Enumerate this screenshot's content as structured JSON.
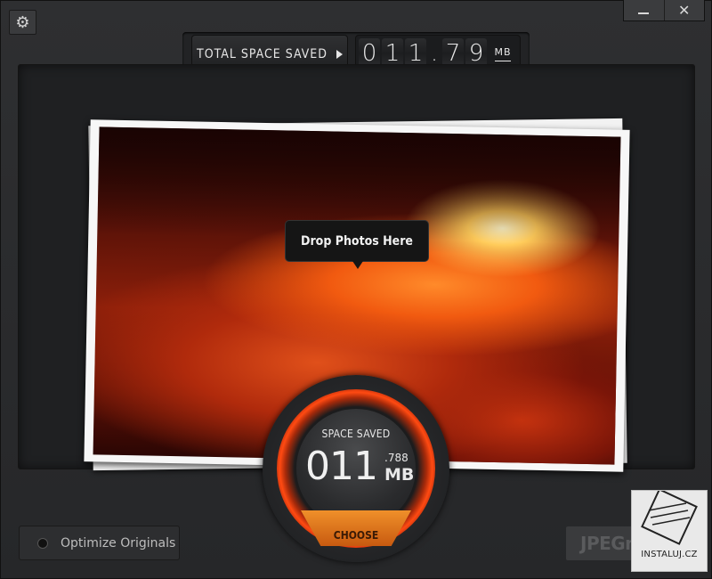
{
  "window": {
    "settings_icon": "gear-icon",
    "minimize_icon": "minimize-icon",
    "close_symbol": "✕",
    "close_icon": "close-icon"
  },
  "counter_header": {
    "label": "TOTAL SPACE SAVED",
    "label_icon": "play-arrow-icon",
    "digits": [
      "0",
      "1",
      "1",
      ".",
      "7",
      "9"
    ],
    "unit": "MB"
  },
  "drop_zone": {
    "tooltip": "Drop Photos Here"
  },
  "dial": {
    "title": "SPACE SAVED",
    "value": "011",
    "decimal": ".788",
    "unit": "MB",
    "choose_label": "CHOOSE"
  },
  "footer": {
    "optimize_label": "Optimize Originals",
    "brand": "JPEGmi",
    "watermark_caption": "INSTALUJ.CZ"
  },
  "colors": {
    "accent": "#f07a18",
    "ring": "#ff4a12",
    "background": "#2a2b2d"
  }
}
